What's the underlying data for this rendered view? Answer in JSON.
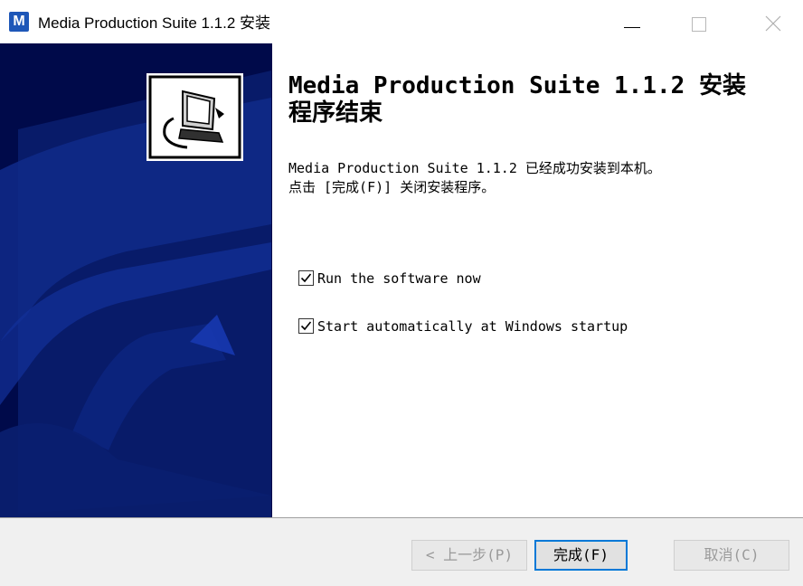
{
  "window": {
    "title": "Media Production Suite 1.1.2 安装",
    "app_icon_letter": "M"
  },
  "heading": "Media Production Suite 1.1.2 安装程序结束",
  "message_line1": "Media Production Suite 1.1.2 已经成功安装到本机。",
  "message_line2": "点击 [完成(F)] 关闭安装程序。",
  "options": [
    {
      "label": "Run the software now",
      "checked": true
    },
    {
      "label": "Start automatically at Windows startup",
      "checked": true
    }
  ],
  "buttons": {
    "back": "< 上一步(P)",
    "finish": "完成(F)",
    "cancel": "取消(C)"
  },
  "colors": {
    "banner_background": "#000a4a",
    "app_icon": "#1e57b8",
    "focus_border": "#0078d7"
  }
}
